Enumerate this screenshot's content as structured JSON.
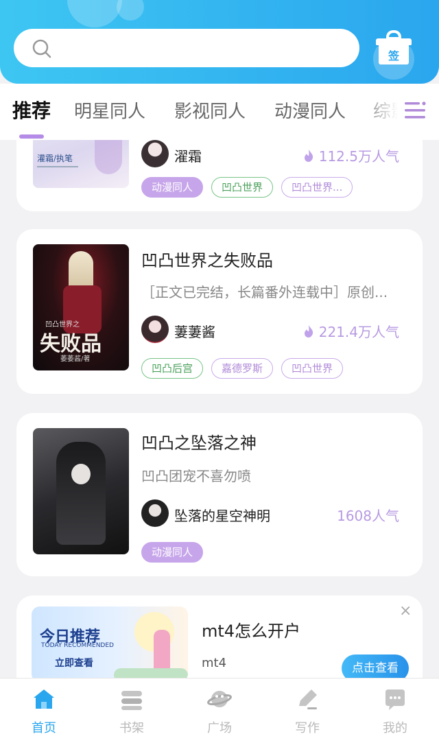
{
  "colors": {
    "accent": "#2aa6ee",
    "tag_purple": "#c7a5ea",
    "tag_green": "#4aa05a",
    "popularity": "#b79ae2"
  },
  "search": {
    "placeholder": "",
    "icon": "search-icon"
  },
  "gift": {
    "label": "签",
    "icon": "gift-checkin-icon"
  },
  "tabs": [
    {
      "label": "推荐"
    },
    {
      "label": "明星同人"
    },
    {
      "label": "影视同人"
    },
    {
      "label": "动漫同人"
    },
    {
      "label": "综影"
    }
  ],
  "menu_icon": "menu-icon",
  "feed": [
    {
      "cover_text": [
        "灌霜/执笔"
      ],
      "author": "濯霜",
      "popularity": "112.5万人气",
      "tags": [
        "动漫同人",
        "凹凸世界",
        "凹凸世界..."
      ]
    },
    {
      "title": "凹凸世界之失败品",
      "desc": "［正文已完结，长篇番外连载中］原创...",
      "cover_text": [
        "凹凸世界之",
        "失败品",
        "萎萎酱/著"
      ],
      "author": "萋萋酱",
      "popularity": "221.4万人气",
      "tags": [
        "凹凸后宫",
        "嘉德罗斯",
        "凹凸世界"
      ]
    },
    {
      "title": "凹凸之坠落之神",
      "desc": "凹凸团宠不喜勿喷",
      "author": "坠落的星空神明",
      "popularity": "1608人气",
      "tags": [
        "动漫同人"
      ]
    }
  ],
  "ad": {
    "title": "mt4怎么开户",
    "subtitle": "mt4",
    "button": "点击查看",
    "close": "×",
    "image_title": "今日推荐",
    "image_sub": "TODAY RECOMMENDED",
    "image_cta": "立即查看"
  },
  "bottom_nav": [
    {
      "label": "首页",
      "icon": "home-icon",
      "active": true
    },
    {
      "label": "书架",
      "icon": "bookshelf-icon",
      "active": false
    },
    {
      "label": "广场",
      "icon": "planet-icon",
      "active": false
    },
    {
      "label": "写作",
      "icon": "pen-icon",
      "active": false
    },
    {
      "label": "我的",
      "icon": "chat-profile-icon",
      "active": false
    }
  ]
}
